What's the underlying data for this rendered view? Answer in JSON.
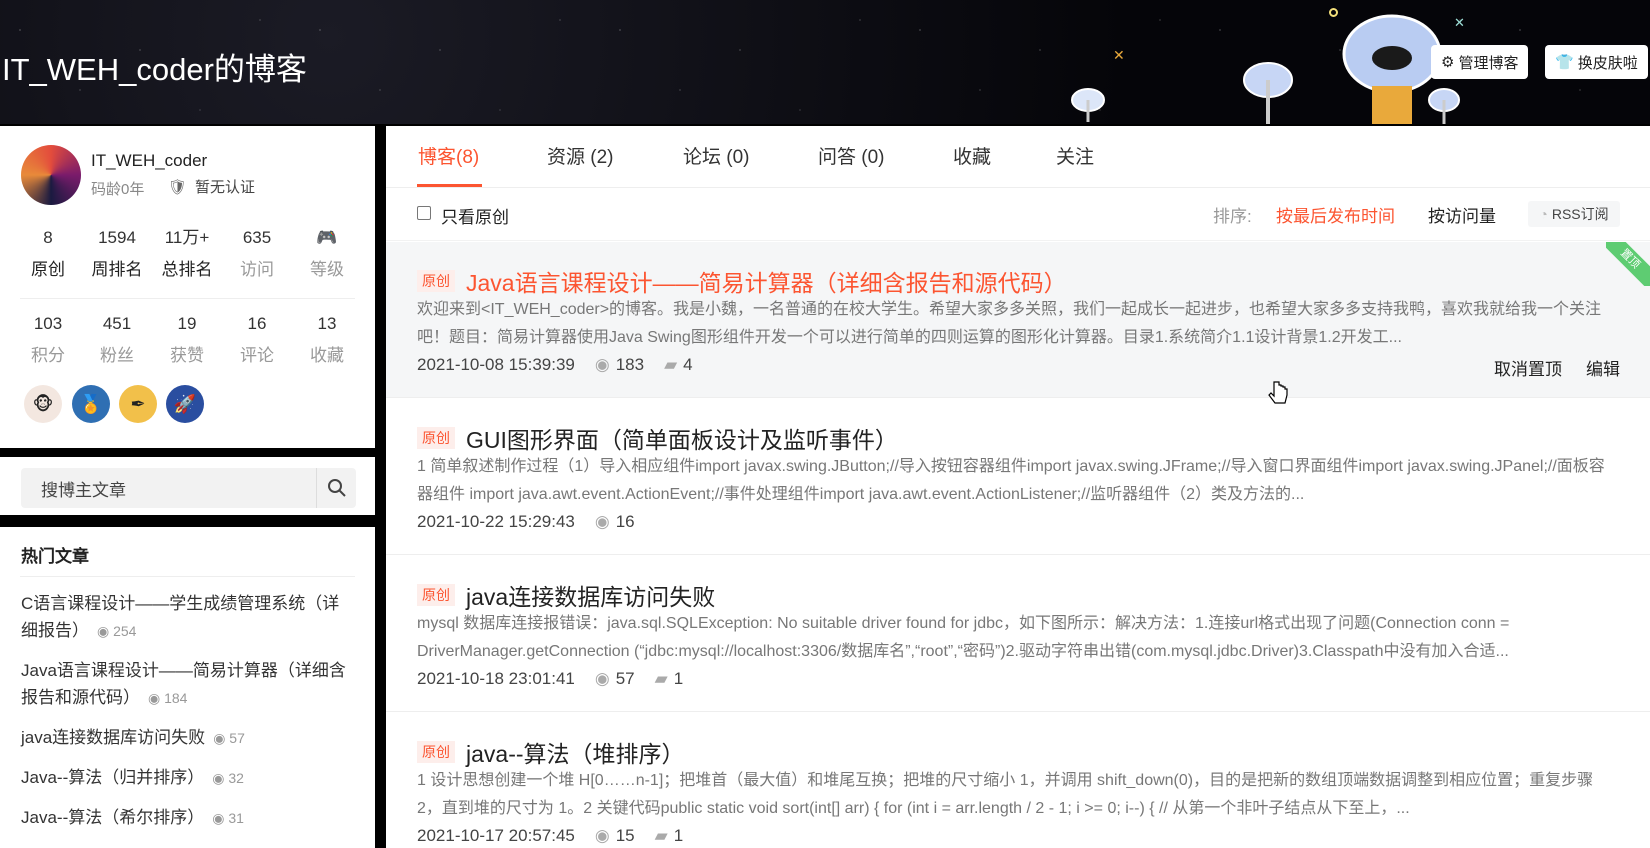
{
  "header": {
    "blog_title": "IT_WEH_coder的博客",
    "manage_label": "管理博客",
    "skin_label": "换皮肤啦"
  },
  "profile": {
    "username": "IT_WEH_coder",
    "code_age": "码龄0年",
    "certification": "暂无认证",
    "stats_row1": [
      {
        "num": "8",
        "label": "原创"
      },
      {
        "num": "1594",
        "label": "周排名"
      },
      {
        "num": "11万+",
        "label": "总排名"
      },
      {
        "num": "635",
        "label": "访问"
      },
      {
        "num": "",
        "label": "等级"
      }
    ],
    "stats_row2": [
      {
        "num": "103",
        "label": "积分"
      },
      {
        "num": "451",
        "label": "粉丝"
      },
      {
        "num": "19",
        "label": "获赞"
      },
      {
        "num": "16",
        "label": "评论"
      },
      {
        "num": "13",
        "label": "收藏"
      }
    ],
    "badges": [
      "monkey-badge-icon",
      "rookie-badge-icon",
      "pen-badge-icon",
      "rocket-badge-icon"
    ]
  },
  "search": {
    "placeholder": "搜博主文章"
  },
  "hot_articles": {
    "title": "热门文章",
    "items": [
      {
        "title": "C语言课程设计——学生成绩管理系统（详细报告）",
        "views": "254"
      },
      {
        "title": "Java语言课程设计——简易计算器（详细含报告和源代码）",
        "views": "184"
      },
      {
        "title": "java连接数据库访问失败",
        "views": "57"
      },
      {
        "title": "Java--算法（归并排序）",
        "views": "32"
      },
      {
        "title": "Java--算法（希尔排序）",
        "views": "31"
      }
    ]
  },
  "tabs": [
    "博客(8)",
    "资源 (2)",
    "论坛 (0)",
    "问答 (0)",
    "收藏",
    "关注"
  ],
  "filter": {
    "only_original": "只看原创",
    "sort_label": "排序:",
    "sort_by_time": "按最后发布时间",
    "sort_by_views": "按访问量",
    "rss": "RSS订阅"
  },
  "articles": [
    {
      "tag": "原创",
      "title": "Java语言课程设计——简易计算器（详细含报告和源代码）",
      "desc": "欢迎来到<IT_WEH_coder>的博客。我是小魏，一名普通的在校大学生。希望大家多多关照，我们一起成长一起进步，也希望大家多多支持我鸭，喜欢我就给我一个关注吧！题目：简易计算器使用Java Swing图形组件开发一个可以进行简单的四则运算的图形化计算器。目录1.系统简介1.1设计背景1.2开发工...",
      "date": "2021-10-08 15:39:39",
      "views": "183",
      "comments": "4",
      "pinned": true,
      "pin_label": "置顶",
      "unpin": "取消置顶",
      "edit": "编辑"
    },
    {
      "tag": "原创",
      "title": "GUI图形界面（简单面板设计及监听事件）",
      "desc": "1 简单叙述制作过程（1）导入相应组件import javax.swing.JButton;//导入按钮容器组件import javax.swing.JFrame;//导入窗口界面组件import javax.swing.JPanel;//面板容器组件 import java.awt.event.ActionEvent;//事件处理组件import java.awt.event.ActionListener;//监听器组件（2）类及方法的...",
      "date": "2021-10-22 15:29:43",
      "views": "16",
      "comments": ""
    },
    {
      "tag": "原创",
      "title": "java连接数据库访问失败",
      "desc": "mysql 数据库连接报错误：java.sql.SQLException: No suitable driver found for jdbc，如下图所示：解决方法：1.连接url格式出现了问题(Connection conn = DriverManager.getConnection (“jdbc:mysql://localhost:3306/数据库名”,“root”,“密码”)2.驱动字符串出错(com.mysql.jdbc.Driver)3.Classpath中没有加入合适...",
      "date": "2021-10-18 23:01:41",
      "views": "57",
      "comments": "1"
    },
    {
      "tag": "原创",
      "title": "java--算法（堆排序）",
      "desc": "1 设计思想创建一个堆 H[0……n-1]；把堆首（最大值）和堆尾互换；把堆的尺寸缩小 1，并调用 shift_down(0)，目的是把新的数组顶端数据调整到相应位置；重复步骤 2，直到堆的尺寸为 1。2 关键代码public static void sort(int[] arr) { for (int i = arr.length / 2 - 1; i >= 0; i--) { // 从第一个非叶子结点从下至上，...",
      "date": "2021-10-17 20:57:45",
      "views": "15",
      "comments": "1"
    }
  ]
}
